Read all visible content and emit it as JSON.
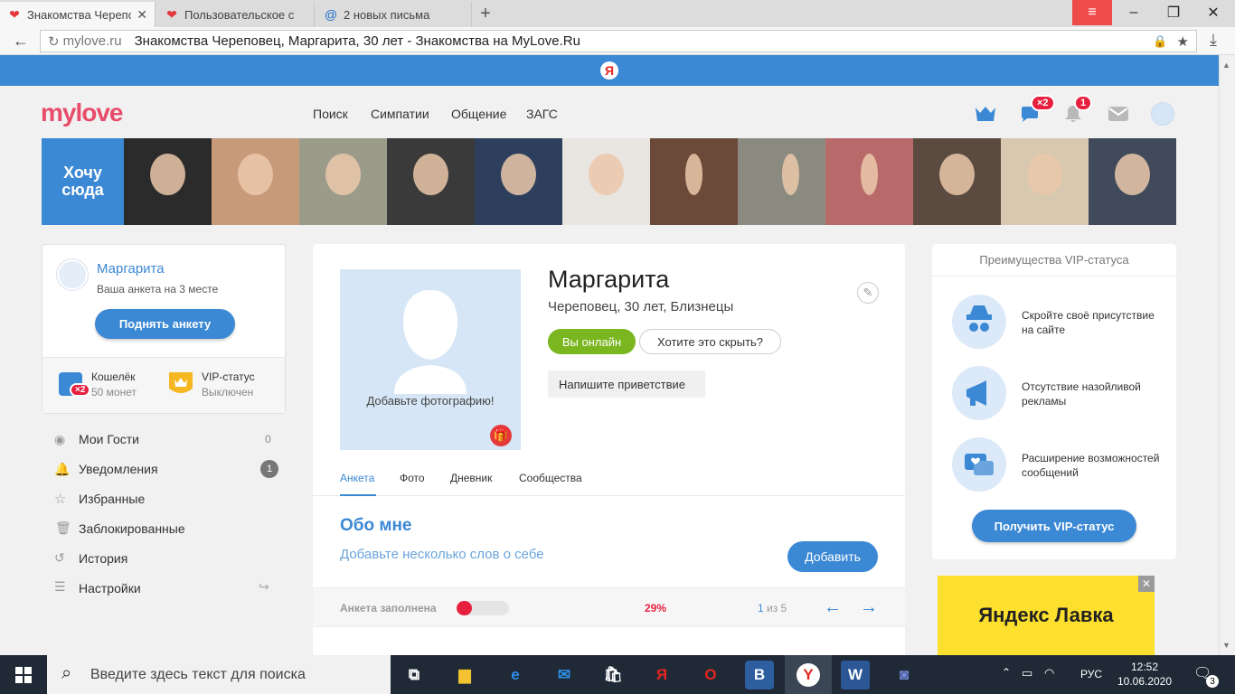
{
  "browser": {
    "tabs": [
      {
        "label": "Знакомства Черепо",
        "icon": "heart-icon",
        "active": true
      },
      {
        "label": "Пользовательское с",
        "icon": "heart-icon",
        "active": false
      },
      {
        "label": "2 новых письма",
        "icon": "mail-at-icon",
        "active": false
      }
    ],
    "new_tab": "+",
    "address_domain": "mylove.ru",
    "address_title": "Знакомства Череповец, Маргарита, 30 лет - Знакомства на MyLove.Ru"
  },
  "site": {
    "logo": "mylove",
    "nav": [
      "Поиск",
      "Симпатии",
      "Общение",
      "ЗАГС"
    ],
    "header_badges": {
      "messages": "×2",
      "notifications": "1"
    },
    "strip": {
      "want_here": "Хочу сюда",
      "photo_colors": [
        "#2b2b2b",
        "#c79a7a",
        "#9b9b8a",
        "#3a3a3a",
        "#2d3f5c",
        "#e9e5e0",
        "#6b4a3a",
        "#8a8a80",
        "#b86a6a",
        "#5a4a40",
        "#d8c8b0",
        "#404a5a"
      ]
    },
    "left": {
      "name": "Маргарита",
      "position": "Ваша анкета на 3 месте",
      "raise_button": "Поднять анкету",
      "wallet_title": "Кошелёк",
      "wallet_value": "50 монет",
      "wallet_badge": "×2",
      "vip_title": "VIP-статус",
      "vip_value": "Выключен",
      "menu": [
        {
          "label": "Мои Гости",
          "count": "0"
        },
        {
          "label": "Уведомления",
          "count": "1"
        },
        {
          "label": "Избранные",
          "count": ""
        },
        {
          "label": "Заблокированные",
          "count": ""
        },
        {
          "label": "История",
          "count": ""
        },
        {
          "label": "Настройки",
          "count": ""
        }
      ]
    },
    "profile": {
      "name": "Маргарита",
      "info": "Череповец, 30 лет, Близнецы",
      "add_photo": "Добавьте фотографию!",
      "online_button": "Вы онлайн",
      "hide_button": "Хотите это скрыть?",
      "greeting_button": "Напишите приветствие",
      "tabs": [
        "Анкета",
        "Фото",
        "Дневник",
        "Сообщества"
      ],
      "about_title": "Обо мне",
      "about_text": "Добавьте несколько слов о себе",
      "add_button": "Добавить",
      "fill_label": "Анкета заполнена",
      "fill_percent": "29%",
      "fill_value": 0.29,
      "page_current": "1",
      "page_of": " из 5"
    },
    "vip": {
      "title": "Преимущества VIP-статуса",
      "items": [
        "Скройте своё присутствие на сайте",
        "Отсутствие назойливой рекламы",
        "Расширение возможностей сообщений"
      ],
      "button": "Получить VIP-статус"
    },
    "ad": {
      "text": "Яндекс Лавка"
    }
  },
  "taskbar": {
    "search_placeholder": "Введите здесь текст для поиска",
    "lang": "РУС",
    "time": "12:52",
    "date": "10.06.2020",
    "notif_count": "3"
  },
  "colors": {
    "accent": "#3b88d4",
    "brand": "#e84c6a",
    "online": "#7ab620",
    "badge": "#e8203f"
  }
}
